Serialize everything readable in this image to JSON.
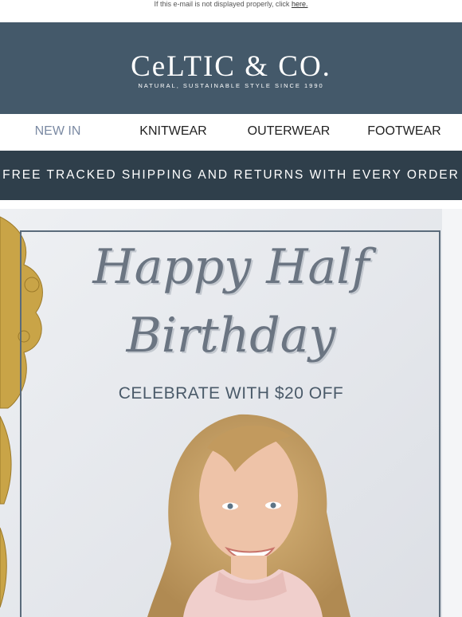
{
  "preheader": {
    "text": "If this e-mail is not displayed properly, click ",
    "link": "here."
  },
  "brand": {
    "logo": "CeLTIC & CO.",
    "tagline": "NATURAL, SUSTAINABLE STYLE SINCE 1990"
  },
  "nav": {
    "items": [
      {
        "label": "NEW IN"
      },
      {
        "label": "KNITWEAR"
      },
      {
        "label": "OUTERWEAR"
      },
      {
        "label": "FOOTWEAR"
      }
    ]
  },
  "shipping": {
    "text": "FREE TRACKED SHIPPING AND RETURNS WITH EVERY ORDER"
  },
  "hero": {
    "headline_line1": "Happy Half",
    "headline_line2": "Birthday",
    "subhead": "CELEBRATE WITH $20 OFF"
  },
  "colors": {
    "header_bg": "#44596a",
    "shipbar_bg": "#2f3f4b",
    "nav_active": "#7b8aa3"
  }
}
